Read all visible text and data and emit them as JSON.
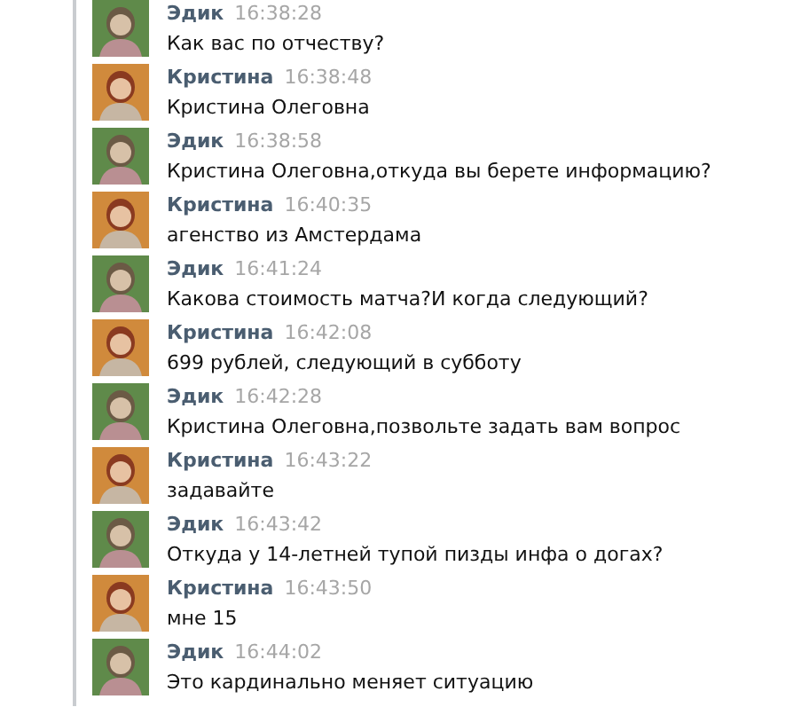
{
  "messages": [
    {
      "kind": "edik",
      "author": "Эдик",
      "time": "16:38:28",
      "text": "Как вас по отчеству?"
    },
    {
      "kind": "kristina",
      "author": "Кристина",
      "time": "16:38:48",
      "text": "Кристина Олеговна"
    },
    {
      "kind": "edik",
      "author": "Эдик",
      "time": "16:38:58",
      "text": "Кристина Олеговна,откуда вы берете информацию?"
    },
    {
      "kind": "kristina",
      "author": "Кристина",
      "time": "16:40:35",
      "text": "агенство из Амстердама"
    },
    {
      "kind": "edik",
      "author": "Эдик",
      "time": "16:41:24",
      "text": "Какова стоимость матча?И когда следующий?"
    },
    {
      "kind": "kristina",
      "author": "Кристина",
      "time": "16:42:08",
      "text": "699 рублей, следующий в субботу"
    },
    {
      "kind": "edik",
      "author": "Эдик",
      "time": "16:42:28",
      "text": "Кристина Олеговна,позвольте задать вам вопрос"
    },
    {
      "kind": "kristina",
      "author": "Кристина",
      "time": "16:43:22",
      "text": "задавайте"
    },
    {
      "kind": "edik",
      "author": "Эдик",
      "time": "16:43:42",
      "text": "Откуда у 14-летней тупой пизды инфа о догах?"
    },
    {
      "kind": "kristina",
      "author": "Кристина",
      "time": "16:43:50",
      "text": "мне 15"
    },
    {
      "kind": "edik",
      "author": "Эдик",
      "time": "16:44:02",
      "text": "Это кардинально меняет ситуацию"
    }
  ]
}
